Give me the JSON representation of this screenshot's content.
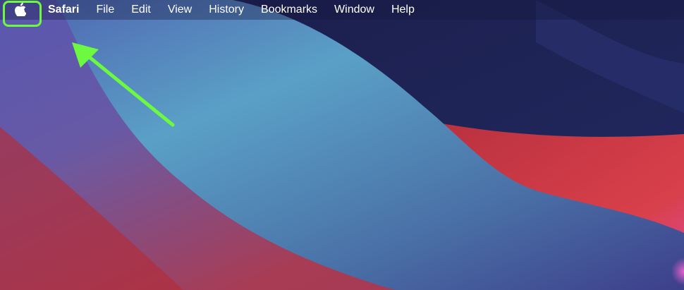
{
  "menubar": {
    "apple_icon": "apple-icon",
    "app_name": "Safari",
    "items": [
      "File",
      "Edit",
      "View",
      "History",
      "Bookmarks",
      "Window",
      "Help"
    ]
  },
  "annotation": {
    "color": "#6cf93f",
    "target": "apple-menu"
  },
  "colors": {
    "sky_top": "#1d2152",
    "wave_blue": "#5a9ec4",
    "wave_red": "#c83a48",
    "left_purple": "#5b4fa6"
  }
}
